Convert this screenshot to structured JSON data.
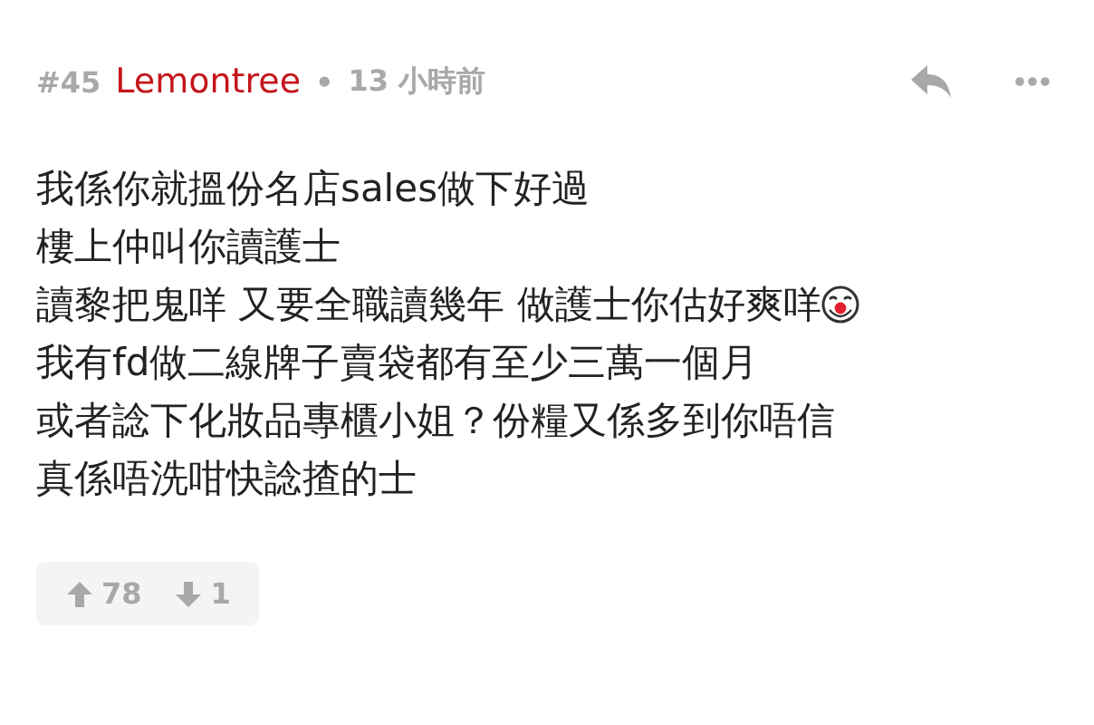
{
  "post": {
    "number": "#45",
    "author": "Lemontree",
    "separator": "•",
    "time": "13 小時前"
  },
  "lines": [
    {
      "text": "我係你就搵份名店sales做下好過"
    },
    {
      "text": "樓上仲叫你讀護士"
    },
    {
      "text": "讀黎把鬼咩 又要全職讀幾年 做護士你估好爽咩",
      "emoji": true
    },
    {
      "text": "我有fd做二線牌子賣袋都有至少三萬一個月"
    },
    {
      "text": "或者諗下化妝品專櫃小姐？份糧又係多到你唔信"
    },
    {
      "text": "真係唔洗咁快諗揸的士"
    }
  ],
  "votes": {
    "up": "78",
    "down": "1"
  }
}
